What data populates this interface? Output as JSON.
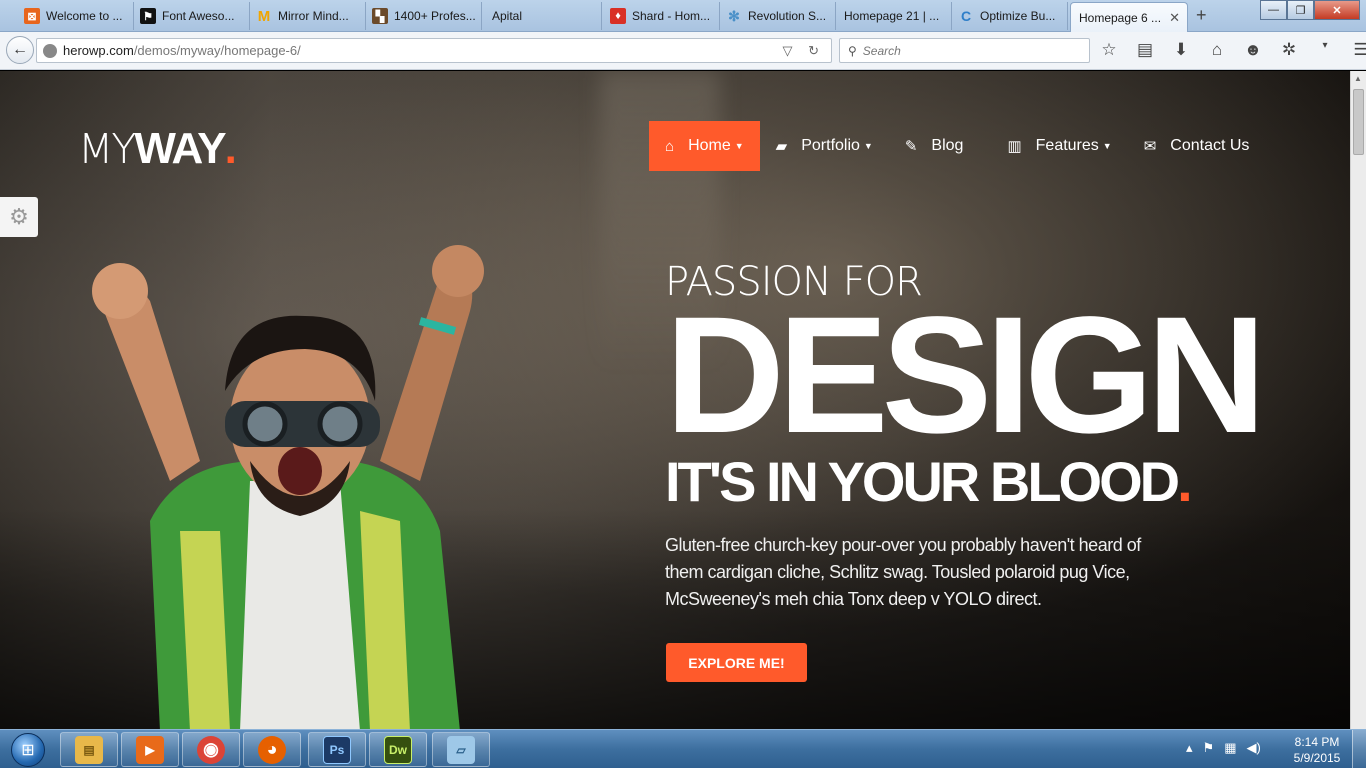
{
  "browser": {
    "tabs": [
      {
        "label": "Welcome to ...",
        "favicon_color": "#e8651c",
        "favicon_glyph": "⊠"
      },
      {
        "label": "Font Aweso...",
        "favicon_color": "#111111",
        "favicon_glyph": "⚑"
      },
      {
        "label": "Mirror Mind...",
        "favicon_color": "#f0a500",
        "favicon_glyph": "M"
      },
      {
        "label": "1400+ Profes...",
        "favicon_color": "#6b4a2a",
        "favicon_glyph": "▚"
      },
      {
        "label": "Apital",
        "favicon_color": "",
        "favicon_glyph": ""
      },
      {
        "label": "Shard - Hom...",
        "favicon_color": "#d93025",
        "favicon_glyph": "♦"
      },
      {
        "label": "Revolution S...",
        "favicon_color": "#4a90c8",
        "favicon_glyph": "✻"
      },
      {
        "label": "Homepage 21 | ...",
        "favicon_color": "",
        "favicon_glyph": ""
      },
      {
        "label": "Optimize Bu...",
        "favicon_color": "#2f7fc9",
        "favicon_glyph": "C"
      },
      {
        "label": "Homepage 6 ...",
        "favicon_color": "",
        "favicon_glyph": "",
        "active": true
      }
    ],
    "new_tab_label": "+",
    "close_tab_label": "✕",
    "url_host": "herowp.com",
    "url_path": "/demos/myway/homepage-6/",
    "search_placeholder": "Search",
    "window_buttons": {
      "minimize": "—",
      "maximize": "❐",
      "close": "✕"
    }
  },
  "site": {
    "logo_thin": "MY",
    "logo_bold": "WAY",
    "logo_dot": ".",
    "nav": [
      {
        "label": "Home",
        "icon": "home-icon",
        "glyph": "⌂",
        "caret": "▼",
        "active": true
      },
      {
        "label": "Portfolio",
        "icon": "briefcase-icon",
        "glyph": "▰",
        "caret": "▼"
      },
      {
        "label": "Blog",
        "icon": "edit-icon",
        "glyph": "✎",
        "caret": ""
      },
      {
        "label": "Features",
        "icon": "building-icon",
        "glyph": "▥",
        "caret": "▼"
      },
      {
        "label": "Contact Us",
        "icon": "envelope-icon",
        "glyph": "✉",
        "caret": ""
      }
    ],
    "accent_color": "#ff5a2b",
    "hero": {
      "pre_title": "PASSION FOR",
      "title": "DESIGN",
      "subtitle": "IT'S IN YOUR BLOOD",
      "subtitle_dot": ".",
      "description": "Gluten-free church-key pour-over you probably haven't heard of them cardigan cliche, Schlitz swag. Tousled polaroid pug Vice, McSweeney's meh chia Tonx deep v YOLO direct.",
      "cta_label": "EXPLORE ME!"
    }
  },
  "taskbar": {
    "apps": [
      {
        "name": "file-explorer-icon",
        "label": "",
        "color": "#e8b84a",
        "glyph": "▤"
      },
      {
        "name": "media-player-icon",
        "label": "",
        "color": "#e86a1a",
        "glyph": "▶"
      },
      {
        "name": "chrome-icon",
        "label": "",
        "color": "#db4437",
        "glyph": "◉"
      },
      {
        "name": "firefox-icon",
        "label": "",
        "color": "#e66000",
        "glyph": "◕"
      },
      {
        "name": "photoshop-icon",
        "label": "Ps",
        "color": "#1c3a66",
        "glyph": ""
      },
      {
        "name": "dreamweaver-icon",
        "label": "Dw",
        "color": "#3a7a1a",
        "glyph": ""
      },
      {
        "name": "notepad-icon",
        "label": "",
        "color": "#9ec8e8",
        "glyph": "▱"
      }
    ],
    "time": "8:14 PM",
    "date": "5/9/2015"
  }
}
